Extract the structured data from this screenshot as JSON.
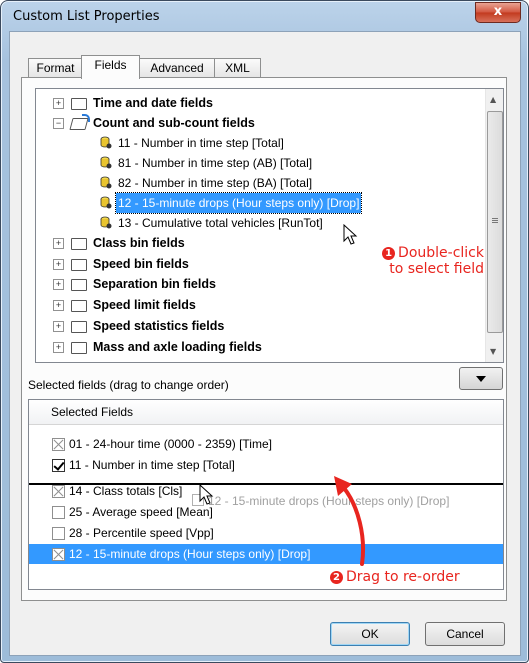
{
  "window": {
    "title": "Custom List Properties",
    "close_glyph": "x"
  },
  "tabs": [
    {
      "label": "Format",
      "active": false
    },
    {
      "label": "Fields",
      "active": true
    },
    {
      "label": "Advanced",
      "active": false
    },
    {
      "label": "XML",
      "active": false
    }
  ],
  "tree": {
    "categories": [
      {
        "label": "Time and date fields",
        "expanded": false
      },
      {
        "label": "Count and sub-count fields",
        "expanded": true
      },
      {
        "label": "Class bin fields",
        "expanded": false
      },
      {
        "label": "Speed bin fields",
        "expanded": false
      },
      {
        "label": "Separation bin fields",
        "expanded": false
      },
      {
        "label": "Speed limit fields",
        "expanded": false
      },
      {
        "label": "Speed statistics fields",
        "expanded": false
      },
      {
        "label": "Mass and axle loading fields",
        "expanded": false
      }
    ],
    "count_children": [
      {
        "label": "11 - Number in time step [Total]",
        "selected": false
      },
      {
        "label": "81 - Number in time step (AB) [Total]",
        "selected": false
      },
      {
        "label": "82 - Number in time step (BA) [Total]",
        "selected": false
      },
      {
        "label": "12 - 15-minute drops (Hour steps only) [Drop]",
        "selected": true
      },
      {
        "label": "13 - Cumulative total vehicles [RunTot]",
        "selected": false
      }
    ],
    "expand_glyph": "+",
    "collapse_glyph": "−"
  },
  "annotations": {
    "step1_number": "1",
    "step1_line1": "Double-click",
    "step1_line2": "to select field",
    "step2_number": "2",
    "step2_text": "Drag to re-order",
    "color": "#e8251f"
  },
  "selected_section": {
    "title": "Selected fields (drag to change order)"
  },
  "selected_list": {
    "header": "Selected Fields",
    "rows": [
      {
        "label": "01 - 24-hour time (0000 - 2359) [Time]",
        "check": "x",
        "highlighted": false
      },
      {
        "label": "11 - Number in time step [Total]",
        "check": "v",
        "highlighted": false
      },
      {
        "label": "14 - Class totals [Cls]",
        "check": "x",
        "highlighted": false
      },
      {
        "label": "25 - Average speed [Mean]",
        "check": "none",
        "highlighted": false
      },
      {
        "label": "28 - Percentile speed [Vpp]",
        "check": "none",
        "highlighted": false
      },
      {
        "label": "12 - 15-minute drops (Hour steps only) [Drop]",
        "check": "x",
        "highlighted": true
      }
    ],
    "drag_ghost": "12 - 15-minute drops (Hour steps only) [Drop]"
  },
  "buttons": {
    "ok": "OK",
    "cancel": "Cancel"
  },
  "colors": {
    "selection": "#3399ff",
    "window_frame": "#a6c2de",
    "close_button": "#c2391e"
  }
}
